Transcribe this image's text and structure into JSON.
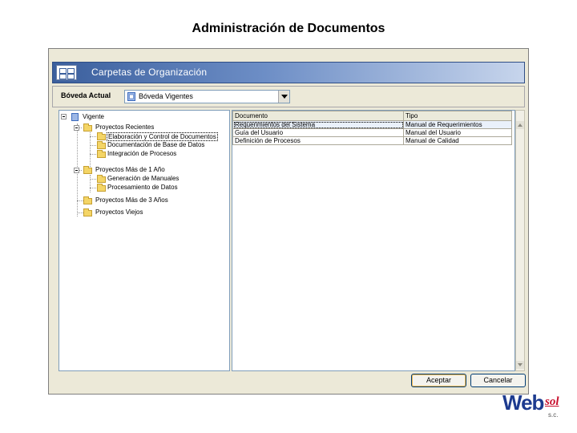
{
  "slide": {
    "title": "Administración de Documentos"
  },
  "window": {
    "header_title": "Carpetas de Organización",
    "boveda": {
      "label": "Bóveda Actual",
      "selected": "Bóveda Vigentes"
    },
    "tree": [
      {
        "label": "Vigente"
      },
      {
        "label": "Proyectos Recientes"
      },
      {
        "label": "Elaboración y Control de Documentos"
      },
      {
        "label": "Documentación de Base de Datos"
      },
      {
        "label": "Integración de Procesos"
      },
      {
        "label": "Proyectos Más de 1 Año"
      },
      {
        "label": "Generación de Manuales"
      },
      {
        "label": "Procesamiento de Datos"
      },
      {
        "label": "Proyectos Más de 3 Años"
      },
      {
        "label": "Proyectos Viejos"
      }
    ],
    "grid": {
      "columns": [
        "Documento",
        "Tipo"
      ],
      "rows": [
        [
          "Requerimientos del Sistema",
          "Manual de Requerimientos"
        ],
        [
          "Guía del Usuario",
          "Manual del Usuario"
        ],
        [
          "Definición de Procesos",
          "Manual de Calidad"
        ]
      ]
    },
    "buttons": {
      "accept": "Aceptar",
      "cancel": "Cancelar"
    }
  },
  "logo": {
    "web": "Web",
    "sol": "sol",
    "suffix": "s.c."
  },
  "colors": {
    "header_band": "#3b5f9d",
    "window_bg": "#ece9d8",
    "logo_blue": "#1d3b8f",
    "logo_red": "#c8102e"
  }
}
